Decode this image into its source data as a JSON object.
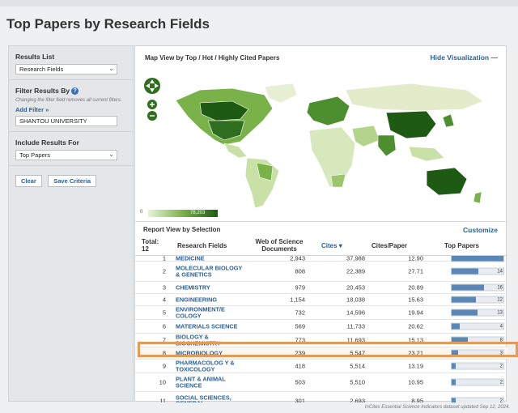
{
  "page": {
    "title": "Top Papers by Research Fields"
  },
  "sidebar": {
    "results_list_label": "Results List",
    "results_list_value": "Research Fields",
    "filter_label": "Filter Results By",
    "filter_hint": "Changing the filter field removes all current filters.",
    "add_filter": "Add Filter »",
    "filter_value": "SHANTOU UNIVERSITY",
    "include_label": "Include Results For",
    "include_value": "Top Papers",
    "clear_label": "Clear",
    "save_label": "Save Criteria"
  },
  "map": {
    "heading": "Map View by Top / Hot / Highly Cited Papers",
    "hide_label": "Hide Visualization",
    "legend_min": "0",
    "legend_max": "78,203",
    "colors": {
      "light": "#e9f3d8",
      "mid": "#7ab24a",
      "dark": "#1e5a14"
    }
  },
  "report": {
    "heading": "Report View by Selection",
    "customize": "Customize",
    "columns": {
      "total_label": "Total:",
      "total_value": "12",
      "field": "Research Fields",
      "wos1": "Web of Science",
      "wos2": "Documents",
      "cites": "Cites ▾",
      "cpp": "Cites/Paper",
      "top": "Top Papers"
    },
    "rows": [
      {
        "rank": "1",
        "field": "MEDICINE",
        "wos": "2,943",
        "cites": "37,988",
        "cpp": "12.90",
        "top_papers": "",
        "fill": 1.0
      },
      {
        "rank": "2",
        "field": "MOLECULAR BIOLOGY & GENETICS",
        "wos": "808",
        "cites": "22,389",
        "cpp": "27.71",
        "top_papers": "14",
        "fill": 0.52
      },
      {
        "rank": "3",
        "field": "CHEMISTRY",
        "wos": "979",
        "cites": "20,453",
        "cpp": "20.89",
        "top_papers": "16",
        "fill": 0.62
      },
      {
        "rank": "4",
        "field": "ENGINEERING",
        "wos": "1,154",
        "cites": "18,038",
        "cpp": "15.63",
        "top_papers": "12",
        "fill": 0.47
      },
      {
        "rank": "5",
        "field": "ENVIRONMENT/E COLOGY",
        "wos": "732",
        "cites": "14,596",
        "cpp": "19.94",
        "top_papers": "13",
        "fill": 0.5
      },
      {
        "rank": "6",
        "field": "MATERIALS SCIENCE",
        "wos": "569",
        "cites": "11,733",
        "cpp": "20.62",
        "top_papers": "4",
        "fill": 0.16
      },
      {
        "rank": "7",
        "field": "BIOLOGY & BIOCHEMISTRY",
        "wos": "773",
        "cites": "11,693",
        "cpp": "15.13",
        "top_papers": "8",
        "fill": 0.31
      },
      {
        "rank": "8",
        "field": "MICROBIOLOGY",
        "wos": "239",
        "cites": "5,547",
        "cpp": "23.21",
        "top_papers": "3",
        "fill": 0.12
      },
      {
        "rank": "9",
        "field": "PHARMACOLOG Y & TOXICOLOGY",
        "wos": "418",
        "cites": "5,514",
        "cpp": "13.19",
        "top_papers": "2",
        "fill": 0.08
      },
      {
        "rank": "10",
        "field": "PLANT & ANIMAL SCIENCE",
        "wos": "503",
        "cites": "5,510",
        "cpp": "10.95",
        "top_papers": "2",
        "fill": 0.08
      },
      {
        "rank": "11",
        "field": "SOCIAL SCIENCES, GENERAL",
        "wos": "301",
        "cites": "2,693",
        "cpp": "8.95",
        "top_papers": "2",
        "fill": 0.08
      }
    ]
  },
  "footer": {
    "note": "InCites Essential Science Indicators dataset updated Sep 12, 2024."
  }
}
